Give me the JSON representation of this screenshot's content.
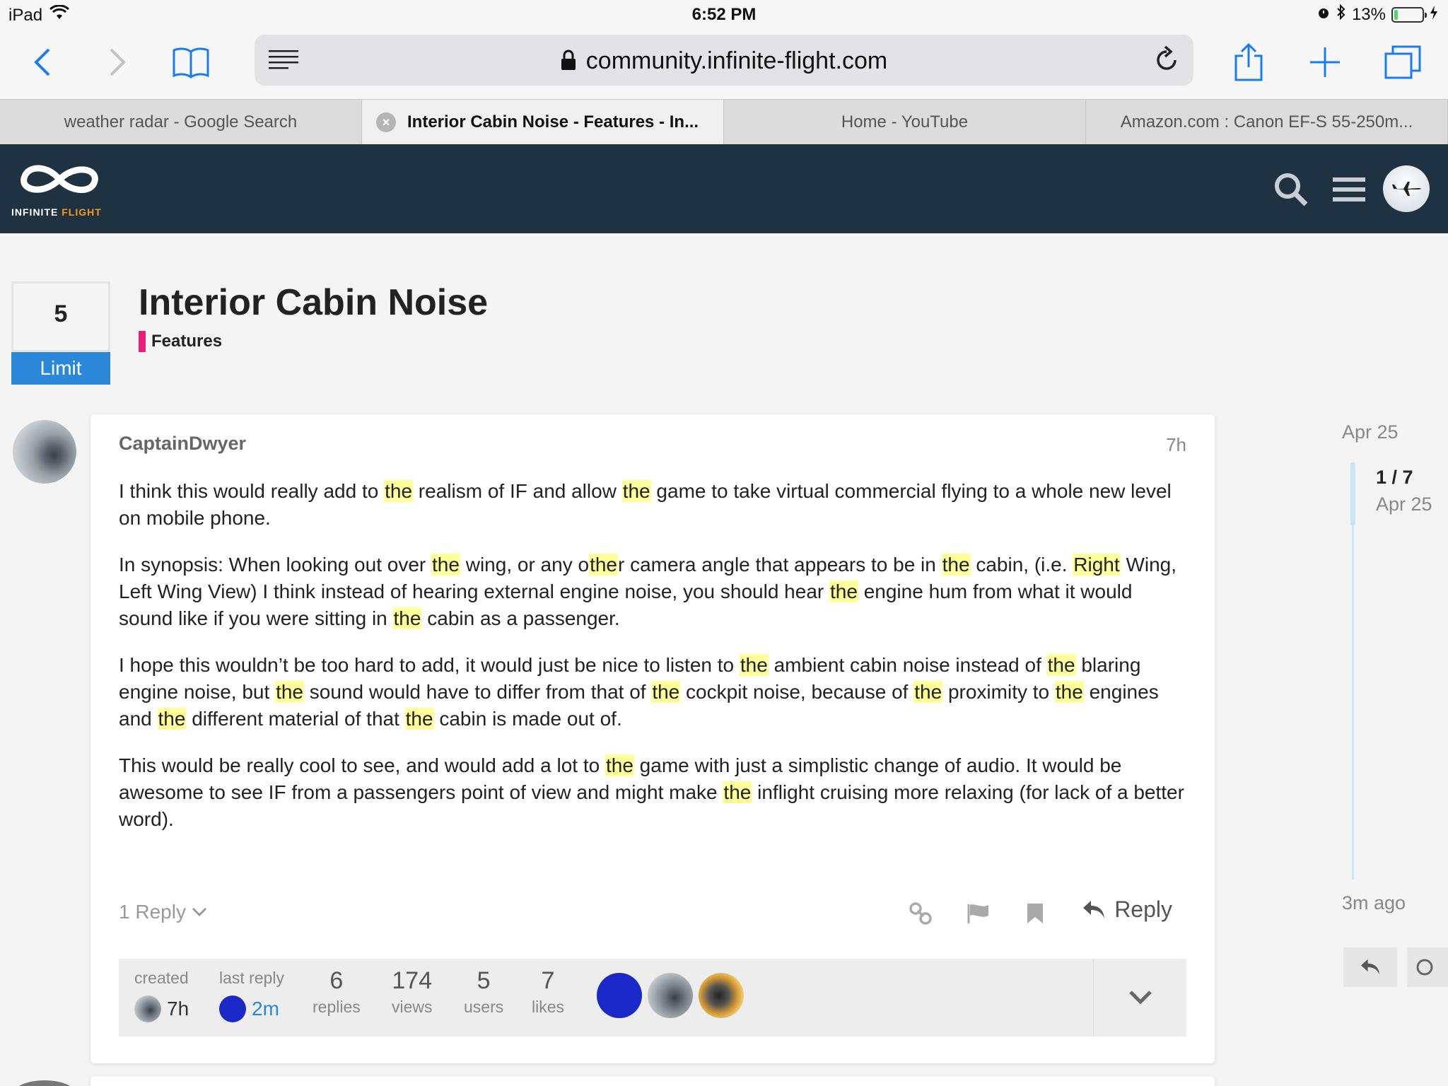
{
  "status_bar": {
    "device": "iPad",
    "time": "6:52 PM",
    "battery_percent": "13%",
    "battery_level": 0.13
  },
  "browser": {
    "url": "community.infinite-flight.com",
    "tabs": [
      {
        "label": "weather radar - Google Search",
        "active": false
      },
      {
        "label": "Interior Cabin Noise - Features - In...",
        "active": true
      },
      {
        "label": "Home - YouTube",
        "active": false
      },
      {
        "label": "Amazon.com : Canon EF-S 55-250m...",
        "active": false
      }
    ]
  },
  "site": {
    "logo_text_1": "INFINITE",
    "logo_text_2": "FLIGHT",
    "header_color": "#1f3241",
    "accent_color": "#f59a1f"
  },
  "topic": {
    "limit_value": "5",
    "limit_label": "Limit",
    "title": "Interior Cabin Noise",
    "category": "Features",
    "category_color": "#e81f76"
  },
  "post": {
    "username": "CaptainDwyer",
    "time": "7h",
    "replies_label": "1 Reply",
    "reply_button": "Reply"
  },
  "topic_map": {
    "created_label": "created",
    "created_value": "7h",
    "last_reply_label": "last reply",
    "last_reply_value": "2m",
    "replies_num": "6",
    "replies_label": "replies",
    "views_num": "174",
    "views_label": "views",
    "users_num": "5",
    "users_label": "users",
    "likes_num": "7",
    "likes_label": "likes"
  },
  "timeline": {
    "top_date": "Apr 25",
    "position": "1 / 7",
    "position_date": "Apr 25",
    "bottom": "3m ago"
  }
}
